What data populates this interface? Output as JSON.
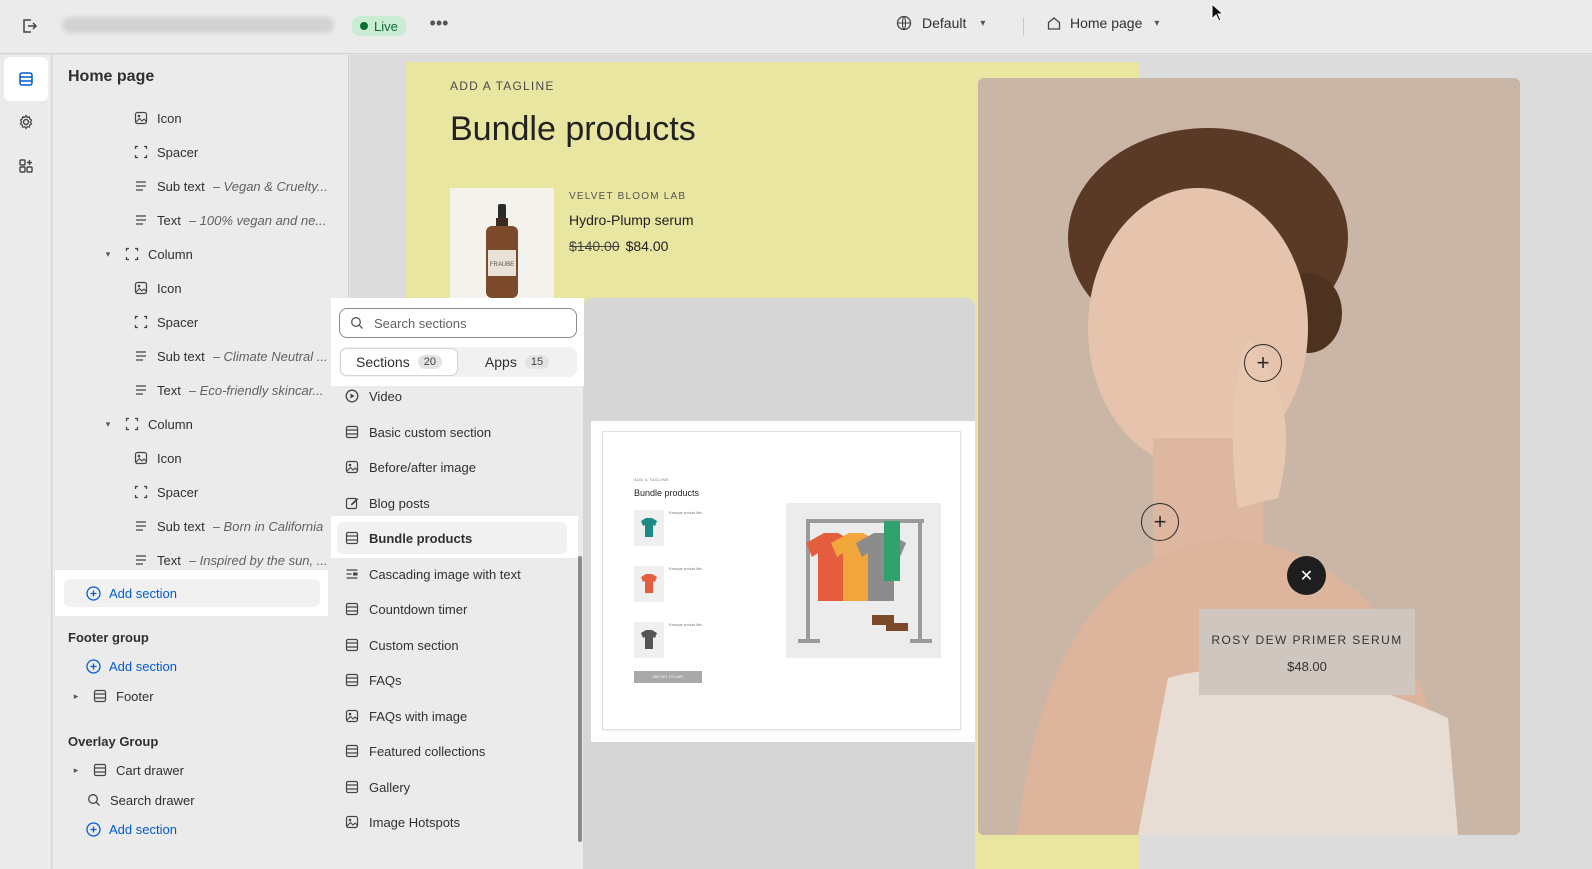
{
  "topbar": {
    "live_label": "Live",
    "theme_label": "Default",
    "page_label": "Home page"
  },
  "sidebar": {
    "title": "Home page",
    "tree": [
      {
        "label": "Icon",
        "sub": ""
      },
      {
        "label": "Spacer",
        "sub": ""
      },
      {
        "label": "Sub text",
        "sub": "– Vegan & Cruelty..."
      },
      {
        "label": "Text",
        "sub": "– 100% vegan and ne..."
      },
      {
        "label": "Column",
        "sub": ""
      },
      {
        "label": "Icon",
        "sub": ""
      },
      {
        "label": "Spacer",
        "sub": ""
      },
      {
        "label": "Sub text",
        "sub": "– Climate Neutral ..."
      },
      {
        "label": "Text",
        "sub": "– Eco-friendly skincar..."
      },
      {
        "label": "Column",
        "sub": ""
      },
      {
        "label": "Icon",
        "sub": ""
      },
      {
        "label": "Spacer",
        "sub": ""
      },
      {
        "label": "Sub text",
        "sub": "– Born in California"
      },
      {
        "label": "Text",
        "sub": "– Inspired by the sun, ..."
      }
    ],
    "add_section": "Add section",
    "footer_group": {
      "title": "Footer group",
      "add_section": "Add section",
      "footer": "Footer"
    },
    "overlay_group": {
      "title": "Overlay Group",
      "cart_drawer": "Cart drawer",
      "search_drawer": "Search drawer",
      "add_section": "Add section"
    }
  },
  "picker": {
    "search_placeholder": "Search sections",
    "tabs": [
      {
        "label": "Sections",
        "count": "20"
      },
      {
        "label": "Apps",
        "count": "15"
      }
    ],
    "items": [
      {
        "label": "Video",
        "icon": "play-icon"
      },
      {
        "label": "Basic custom section",
        "icon": "section-icon"
      },
      {
        "label": "Before/after image",
        "icon": "image-icon"
      },
      {
        "label": "Blog posts",
        "icon": "edit-icon"
      },
      {
        "label": "Bundle products",
        "icon": "section-icon"
      },
      {
        "label": "Cascading image with text",
        "icon": "text-image-icon"
      },
      {
        "label": "Countdown timer",
        "icon": "section-icon"
      },
      {
        "label": "Custom section",
        "icon": "section-icon"
      },
      {
        "label": "FAQs",
        "icon": "section-icon"
      },
      {
        "label": "FAQs with image",
        "icon": "image-icon"
      },
      {
        "label": "Featured collections",
        "icon": "section-icon"
      },
      {
        "label": "Gallery",
        "icon": "section-icon"
      },
      {
        "label": "Image Hotspots",
        "icon": "image-icon"
      }
    ],
    "preview": {
      "tagline": "ADD A TAGLINE",
      "title": "Bundle products",
      "item_label": "Example product title",
      "button": "ADD SET TO CART"
    }
  },
  "storefront": {
    "tagline": "ADD A TAGLINE",
    "title": "Bundle products",
    "product": {
      "brand": "VELVET BLOOM LAB",
      "name": "Hydro-Plump serum",
      "old_price": "$140.00",
      "price": "$84.00"
    },
    "hotspot_card": {
      "name": "ROSY DEW PRIMER SERUM",
      "price": "$48.00"
    }
  },
  "colors": {
    "accent_blue": "#005bd3",
    "live_green": "#0e6b34",
    "hero_yellow": "#e8e6a0"
  }
}
